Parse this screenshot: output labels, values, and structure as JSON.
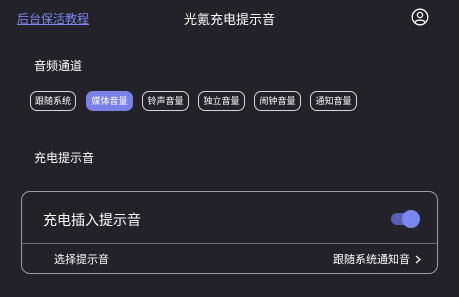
{
  "header": {
    "tutorial_link": "后台保活教程",
    "title": "光氪充电提示音"
  },
  "audio_channel": {
    "title": "音频通道",
    "options": [
      {
        "label": "跟随系统",
        "active": false
      },
      {
        "label": "媒体音量",
        "active": true
      },
      {
        "label": "铃声音量",
        "active": false
      },
      {
        "label": "独立音量",
        "active": false
      },
      {
        "label": "闹钟音量",
        "active": false
      },
      {
        "label": "通知音量",
        "active": false
      }
    ]
  },
  "charge_sound": {
    "title": "充电提示音",
    "plug_in_switch": {
      "label": "充电插入提示音",
      "enabled": true
    },
    "choose_sound": {
      "label": "选择提示音",
      "value": "跟随系统通知音"
    }
  },
  "colors": {
    "background": "#232228",
    "accent": "#7a82ea"
  },
  "icons": {
    "account": "account-circle-icon",
    "chevron": "chevron-right-icon"
  }
}
